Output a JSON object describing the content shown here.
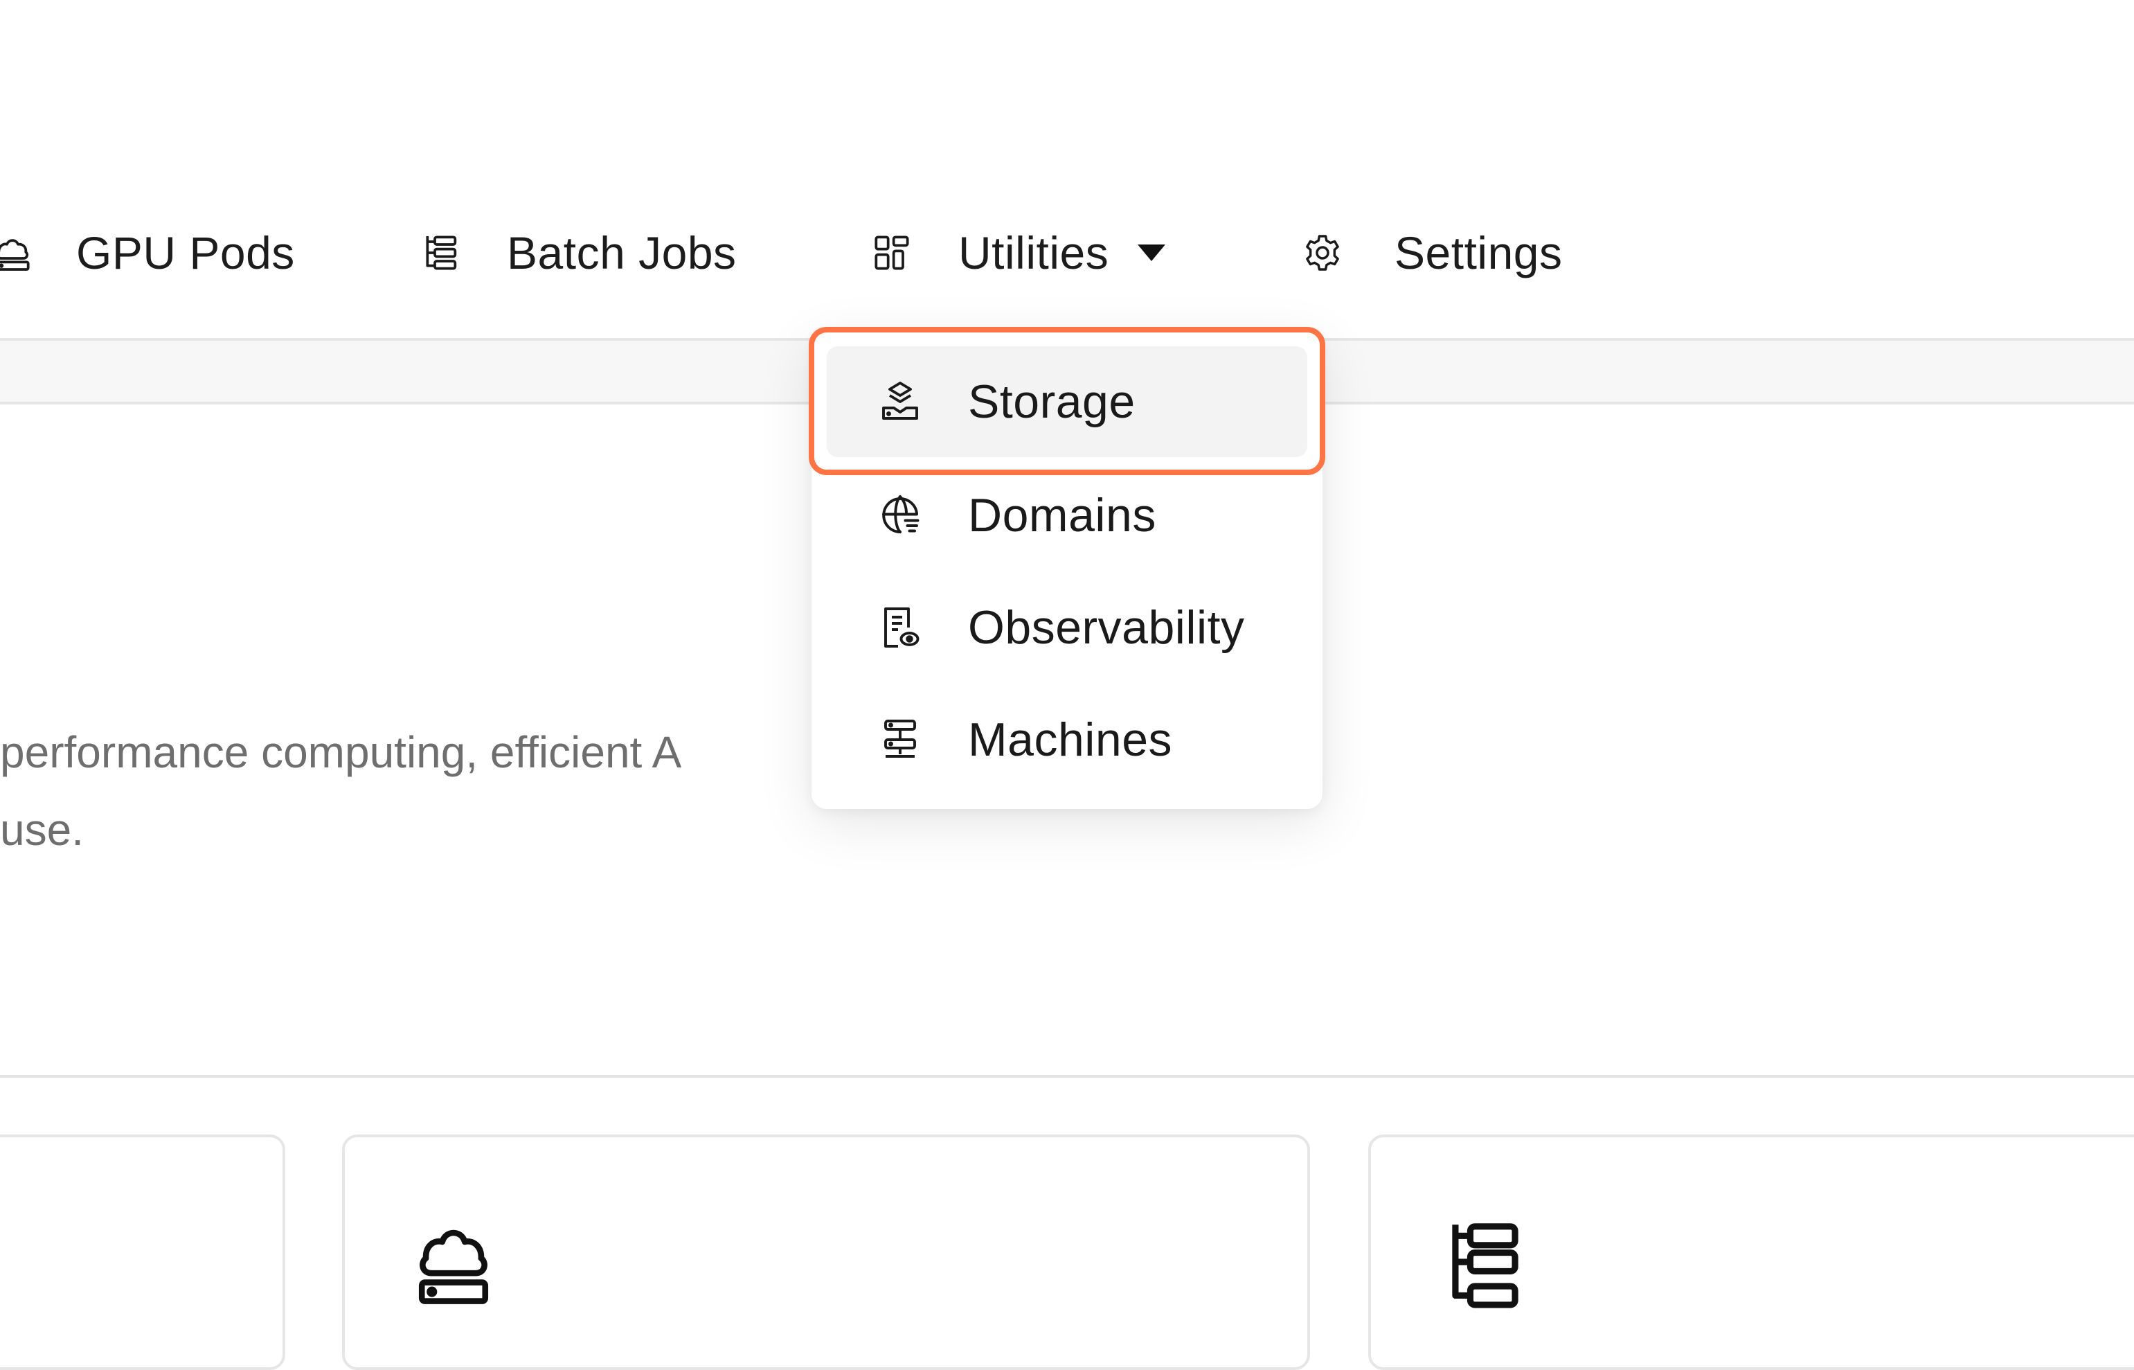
{
  "nav": {
    "items": [
      {
        "label": "GPU Pods",
        "icon": "cloud-server-icon"
      },
      {
        "label": "Batch Jobs",
        "icon": "hierarchy-list-icon"
      },
      {
        "label": "Utilities",
        "icon": "grid-icon",
        "has_dropdown": true,
        "expanded": true
      },
      {
        "label": "Settings",
        "icon": "gear-icon"
      }
    ]
  },
  "dropdown": {
    "items": [
      {
        "label": "Storage",
        "icon": "layers-tray-icon",
        "highlighted": true
      },
      {
        "label": "Domains",
        "icon": "globe-icon"
      },
      {
        "label": "Observability",
        "icon": "document-eye-icon"
      },
      {
        "label": "Machines",
        "icon": "server-rack-icon"
      }
    ]
  },
  "hero": {
    "description_lines": [
      "performance computing, efficient A",
      "use."
    ]
  },
  "cards": [
    {
      "icon": ""
    },
    {
      "icon": "cloud-server-icon"
    },
    {
      "icon": "hierarchy-list-icon"
    }
  ],
  "colors": {
    "highlight_ring": "#ff7445",
    "highlighted_item_bg": "#f3f3f3",
    "description_text": "#6e6e6e"
  }
}
